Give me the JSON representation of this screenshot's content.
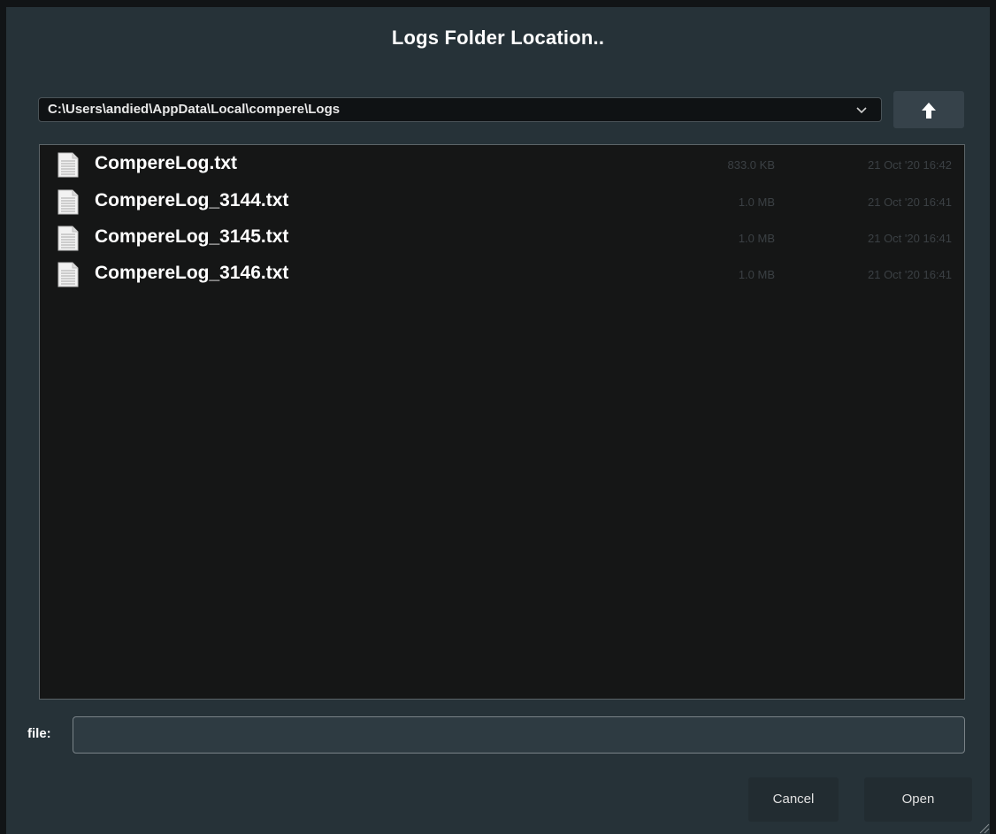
{
  "dialog": {
    "title": "Logs Folder Location..",
    "path": "C:\\Users\\andied\\AppData\\Local\\compere\\Logs",
    "up_icon": "arrow-up-icon",
    "dropdown_icon": "chevron-down-icon"
  },
  "files": [
    {
      "name": "CompereLog.txt",
      "size": "833.0 KB",
      "date": "21 Oct '20 16:42"
    },
    {
      "name": "CompereLog_3144.txt",
      "size": "1.0 MB",
      "date": "21 Oct '20 16:41"
    },
    {
      "name": "CompereLog_3145.txt",
      "size": "1.0 MB",
      "date": "21 Oct '20 16:41"
    },
    {
      "name": "CompereLog_3146.txt",
      "size": "1.0 MB",
      "date": "21 Oct '20 16:41"
    }
  ],
  "file_field": {
    "label": "file:",
    "value": ""
  },
  "buttons": {
    "cancel": "Cancel",
    "open": "Open"
  }
}
